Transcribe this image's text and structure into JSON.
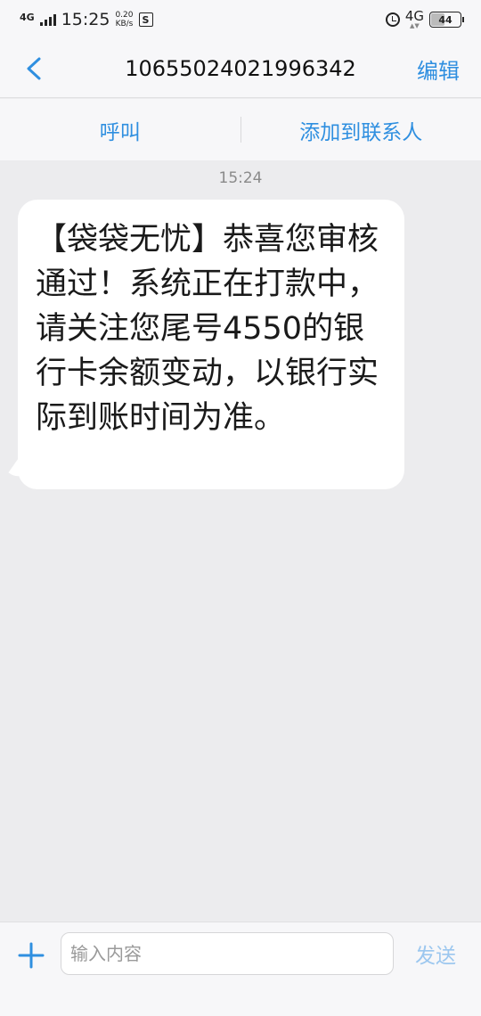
{
  "status_bar": {
    "network": "4G",
    "time": "15:25",
    "speed_value": "0.20",
    "speed_unit": "KB/s",
    "s_label": "S",
    "network_right": "4G",
    "battery": "44"
  },
  "header": {
    "title": "10655024021996342",
    "edit_label": "编辑"
  },
  "actions": {
    "call_label": "呼叫",
    "add_contact_label": "添加到联系人"
  },
  "conversation": {
    "timestamp": "15:24",
    "message": "【袋袋无忧】恭喜您审核通过！系统正在打款中，请关注您尾号4550的银行卡余额变动，以银行实际到账时间为准。"
  },
  "composer": {
    "placeholder": "输入内容",
    "send_label": "发送"
  },
  "colors": {
    "accent": "#2f8fe0",
    "send_disabled": "#9cc7ef",
    "background": "#ececee"
  }
}
